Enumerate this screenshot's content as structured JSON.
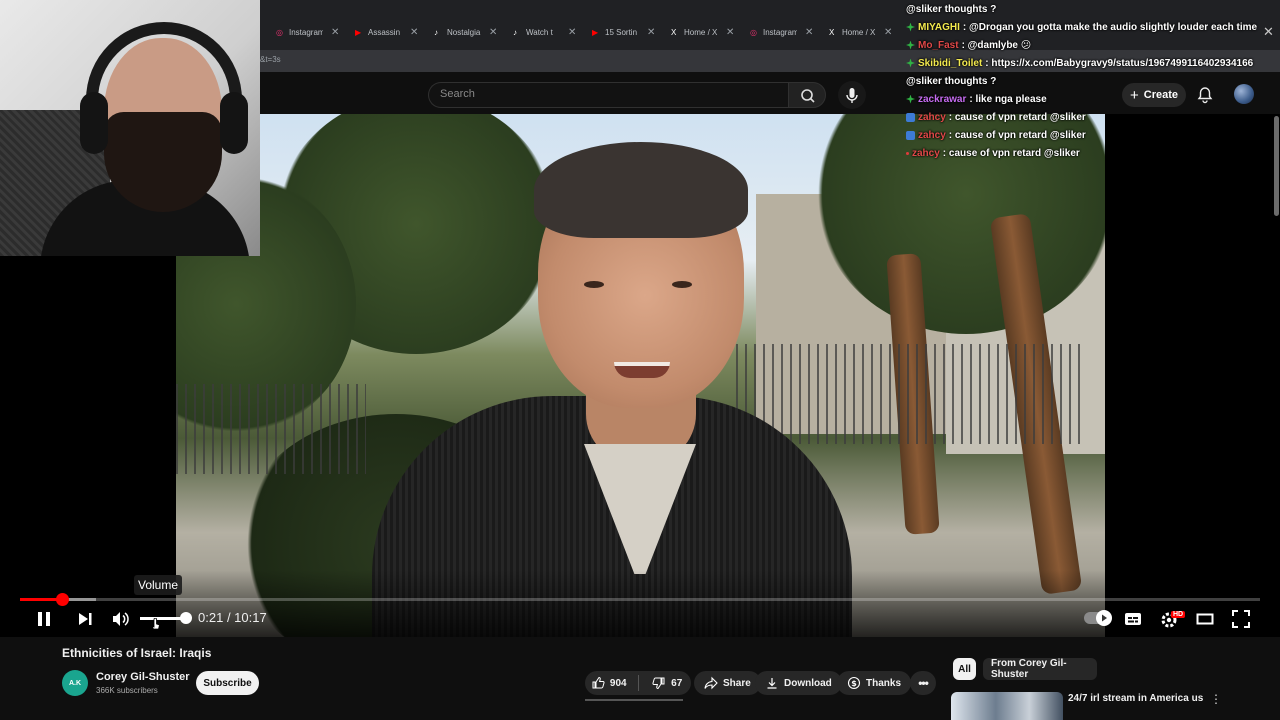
{
  "browser": {
    "tabs": [
      {
        "label": "Instagram",
        "icon": "instagram-icon",
        "color": "#e1306c"
      },
      {
        "label": "Assassin",
        "icon": "youtube-icon",
        "color": "#ff0000"
      },
      {
        "label": "Nostalgia",
        "icon": "tiktok-icon",
        "color": "#ffffff"
      },
      {
        "label": "Watch t",
        "icon": "tiktok-icon",
        "color": "#ffffff"
      },
      {
        "label": "15 Sortin",
        "icon": "youtube-icon",
        "color": "#ff0000"
      },
      {
        "label": "Home / X",
        "icon": "x-icon",
        "color": "#ffffff"
      },
      {
        "label": "Instagram",
        "icon": "instagram-icon",
        "color": "#e1306c"
      },
      {
        "label": "Home / X",
        "icon": "x-icon",
        "color": "#ffffff"
      }
    ],
    "url_fragment": "&t=3s"
  },
  "masthead": {
    "search_placeholder": "Search",
    "create_label": "Create"
  },
  "chat": [
    {
      "user": "",
      "user_color": "#ffffff",
      "badge": "none",
      "message": "@sliker thoughts ?"
    },
    {
      "user": "MIYAGHI",
      "user_color": "#f2e94e",
      "badge": "green",
      "message": ": @Drogan you gotta make the audio slightly louder each time"
    },
    {
      "user": "Mo_Fast",
      "user_color": "#e04848",
      "badge": "green",
      "message": ": @damlybe 😕"
    },
    {
      "user": "Skibidi_Toilet",
      "user_color": "#f2e94e",
      "badge": "green",
      "message": ": https://x.com/Babygravy9/status/1967499116402934166"
    },
    {
      "user": "",
      "user_color": "#ffffff",
      "badge": "none",
      "message": "@sliker thoughts ?"
    },
    {
      "user": "zackrawar",
      "user_color": "#c56cf0",
      "badge": "green",
      "message": ": like nga please"
    },
    {
      "user": "zahcy",
      "user_color": "#e04848",
      "badge": "blue",
      "message": ": cause of vpn retard @sliker"
    },
    {
      "user": "zahcy",
      "user_color": "#e04848",
      "badge": "blue",
      "message": ": cause of vpn retard @sliker"
    },
    {
      "user": "zahcy",
      "user_color": "#e04848",
      "badge": "dot",
      "message": ": cause of vpn retard @sliker"
    }
  ],
  "player": {
    "current_time": "0:21",
    "duration": "10:17",
    "progress_fraction": 0.034,
    "buffered_fraction": 0.061,
    "volume_fraction": 1.0,
    "tooltip": "Volume",
    "hd_badge": "HD"
  },
  "video": {
    "title": "Ethnicities of Israel: Iraqis",
    "channel_name": "Corey Gil-Shuster",
    "channel_avatar_text": "A.K",
    "subscribers": "366K subscribers",
    "subscribe_label": "Subscribe",
    "likes": "904",
    "dislikes": "67",
    "share_label": "Share",
    "download_label": "Download",
    "thanks_label": "Thanks"
  },
  "sidebar": {
    "chips": [
      "All",
      "From Corey Gil-Shuster"
    ],
    "recommendation_title": "24/7 irl stream in America us"
  },
  "colors": {
    "accent": "#ff0000",
    "background": "#0f0f0f",
    "pill": "#272727"
  }
}
